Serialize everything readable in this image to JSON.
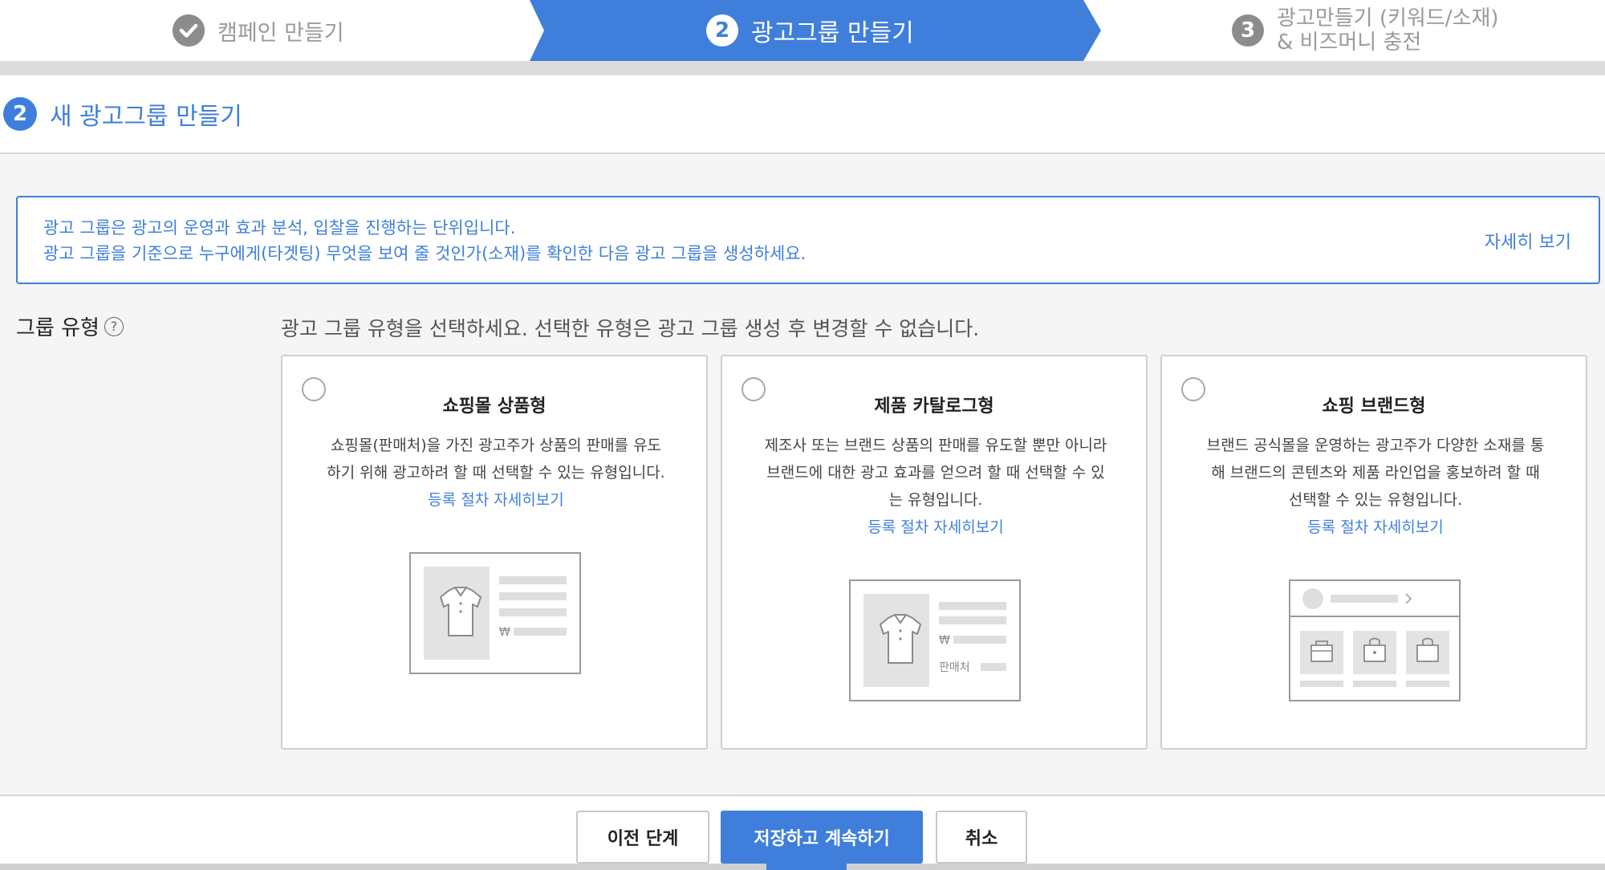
{
  "steps": [
    {
      "number": "✓",
      "label": "캠페인 만들기"
    },
    {
      "number": "2",
      "label": "광고그룹 만들기"
    },
    {
      "number": "3",
      "label_line1": "광고만들기 (키워드/소재)",
      "label_line2": "& 비즈머니 충전"
    }
  ],
  "section": {
    "number": "2",
    "title": "새 광고그룹 만들기"
  },
  "info": {
    "line1": "광고 그룹은 광고의 운영과 효과 분석, 입찰을 진행하는 단위입니다.",
    "line2": "광고 그룹을 기준으로 누구에게(타겟팅) 무엇을 보여 줄 것인가(소재)를 확인한 다음 광고 그룹을 생성하세요.",
    "more_label": "자세히 보기"
  },
  "group_type": {
    "label": "그룹 유형",
    "help_symbol": "?",
    "description": "광고 그룹 유형을 선택하세요. 선택한 유형은 광고 그룹 생성 후 변경할 수 없습니다.",
    "cards": [
      {
        "title": "쇼핑몰 상품형",
        "desc_line1": "쇼핑몰(판매처)을 가진 광고주가 상품의 판매를 유도",
        "desc_line2": "하기 위해 광고하려 할 때 선택할 수 있는 유형입니다.",
        "link": "등록 절차 자세히보기",
        "price_symbol": "₩"
      },
      {
        "title": "제품 카탈로그형",
        "desc_line1": "제조사 또는 브랜드 상품의 판매를 유도할 뿐만 아니라",
        "desc_line2": "브랜드에 대한 광고 효과를 얻으려 할 때 선택할 수 있",
        "desc_line3": "는 유형입니다.",
        "link": "등록 절차 자세히보기",
        "price_symbol": "₩",
        "seller_label": "판매처"
      },
      {
        "title": "쇼핑 브랜드형",
        "desc_line1": "브랜드 공식몰을 운영하는 광고주가 다양한 소재를 통",
        "desc_line2": "해 브랜드의 콘텐츠와 제품 라인업을 홍보하려 할 때",
        "desc_line3": "선택할 수 있는 유형입니다.",
        "link": "등록 절차 자세히보기"
      }
    ]
  },
  "buttons": {
    "prev": "이전 단계",
    "save": "저장하고 계속하기",
    "cancel": "취소"
  },
  "colors": {
    "accent": "#3f7fdb",
    "muted": "#9a9a9a",
    "border": "#cfcfcf"
  }
}
